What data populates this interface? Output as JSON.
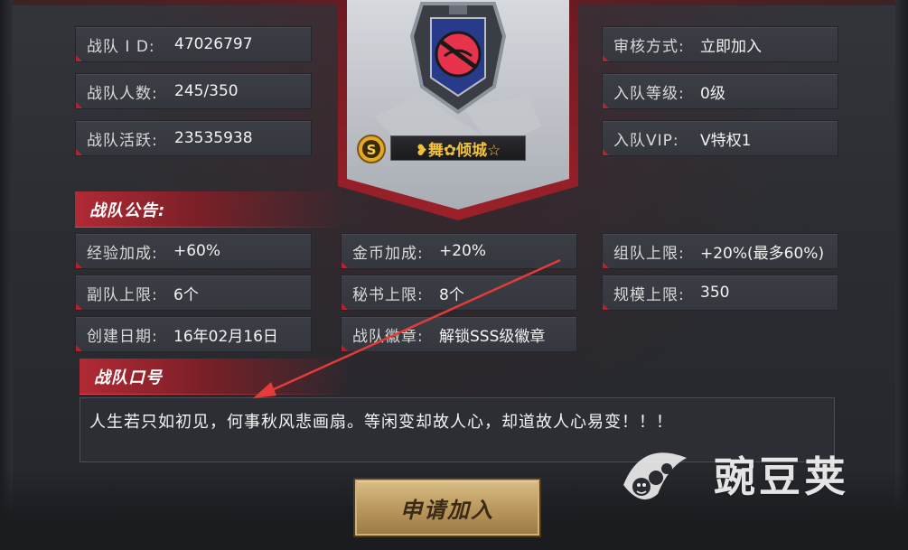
{
  "left_info": [
    {
      "label": "战队 I D:",
      "value": "47026797"
    },
    {
      "label": "战队人数:",
      "value": "245/350"
    },
    {
      "label": "战队活跃:",
      "value": "23535938"
    }
  ],
  "right_info": [
    {
      "label": "审核方式:",
      "value": "立即加入"
    },
    {
      "label": "入队等级:",
      "value": "0级"
    },
    {
      "label": "入队VIP:",
      "value": "V特权1"
    }
  ],
  "leader_nickname": "❥舞✿倾城☆",
  "notice_title": "战队公告:",
  "stats": [
    {
      "label": "经验加成:",
      "value": "+60%"
    },
    {
      "label": "金币加成:",
      "value": "+20%"
    },
    {
      "label": "组队上限:",
      "value": "+20%(最多60%)"
    },
    {
      "label": "副队上限:",
      "value": "6个"
    },
    {
      "label": "秘书上限:",
      "value": "8个"
    },
    {
      "label": "规模上限:",
      "value": "350"
    },
    {
      "label": "创建日期:",
      "value": "16年02月16日"
    },
    {
      "label": "战队徽章:",
      "value": "解锁SSS级徽章"
    }
  ],
  "slogan_title": "战队口号",
  "slogan_text": "人生若只如初见，何事秋风悲画扇。等闲变却故人心，却道故人心易变！！！",
  "join_button": "申请加入",
  "watermark_text": "豌豆荚",
  "colors": {
    "accent_red": "#b12a34",
    "gold": "#cfb27a"
  }
}
